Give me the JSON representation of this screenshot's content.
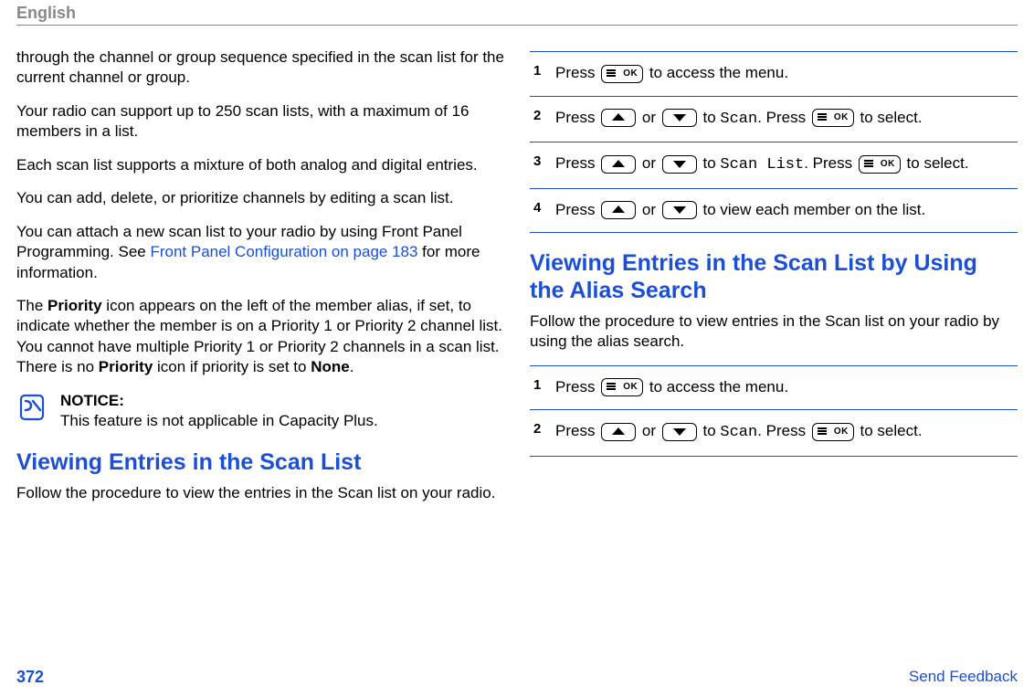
{
  "header": {
    "language": "English"
  },
  "left_column": {
    "paragraphs": [
      "through the channel or group sequence specified in the scan list for the current channel or group.",
      "Your radio can support up to 250 scan lists, with a maximum of 16 members in a list.",
      "Each scan list supports a mixture of both analog and digital entries.",
      "You can add, delete, or prioritize channels by editing a scan list."
    ],
    "front_panel": {
      "pre": "You can attach a new scan list to your radio by using Front Panel Programming. See ",
      "link": "Front Panel Configuration on page 183",
      "post": " for more information."
    },
    "priority": {
      "p1_a": "The ",
      "p1_b": "Priority",
      "p1_c": " icon appears on the left of the member alias, if set, to indicate whether the member is on a Priority 1 or Priority 2 channel list. You cannot have multiple Priority 1 or Priority 2 channels in a scan list. There is no ",
      "p1_d": "Priority",
      "p1_e": " icon if priority is set to ",
      "p1_f": "None",
      "p1_g": "."
    },
    "notice": {
      "title": "NOTICE:",
      "text": "This feature is not applicable in Capacity Plus."
    },
    "section1": {
      "title": "Viewing Entries in the Scan List",
      "intro": "Follow the procedure to view the entries in the Scan list on your radio."
    }
  },
  "right_column": {
    "steps_a": [
      {
        "num": "1",
        "t1": "Press ",
        "t2": " to access the menu."
      },
      {
        "num": "2",
        "t1": "Press ",
        "or": " or ",
        "to": " to ",
        "code": "Scan",
        "period": ". Press ",
        "t2": " to select."
      },
      {
        "num": "3",
        "t1": "Press ",
        "or": " or ",
        "to": " to ",
        "code": "Scan List",
        "period": ". Press ",
        "t2": " to select."
      },
      {
        "num": "4",
        "t1": "Press ",
        "or": " or ",
        "to": " to view each member on the list."
      }
    ],
    "section2": {
      "title": "Viewing Entries in the Scan List by Using the Alias Search",
      "intro": "Follow the procedure to view entries in the Scan list on your radio by using the alias search."
    },
    "steps_b": [
      {
        "num": "1",
        "t1": "Press ",
        "t2": " to access the menu."
      },
      {
        "num": "2",
        "t1": "Press ",
        "or": " or ",
        "to": " to ",
        "code": "Scan",
        "period": ". Press ",
        "t2": " to select."
      }
    ]
  },
  "footer": {
    "page_number": "372",
    "feedback": "Send Feedback"
  }
}
